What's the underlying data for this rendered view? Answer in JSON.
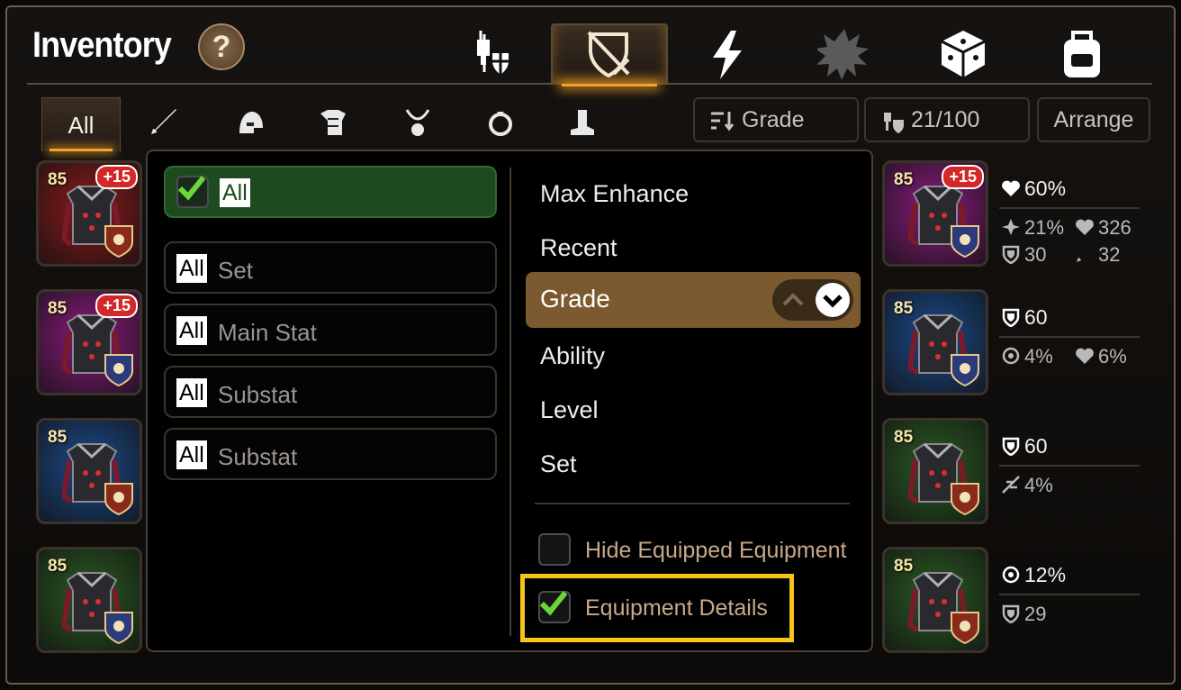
{
  "header": {
    "title": "Inventory",
    "help_label": "?",
    "tabs": [
      {
        "icon": "knight-helmet-shield-icon"
      },
      {
        "icon": "crossed-sword-shield-icon",
        "active": true
      },
      {
        "icon": "lightning-icon"
      },
      {
        "icon": "spiky-burst-icon"
      },
      {
        "icon": "dice-cube-icon"
      },
      {
        "icon": "backpack-icon"
      }
    ]
  },
  "categories": {
    "all_label": "All",
    "items": [
      {
        "icon": "sword-icon"
      },
      {
        "icon": "helmet-icon"
      },
      {
        "icon": "armor-icon"
      },
      {
        "icon": "necklace-icon"
      },
      {
        "icon": "ring-icon"
      },
      {
        "icon": "boots-icon"
      }
    ]
  },
  "toolbar": {
    "sort_label": "Grade",
    "capacity_label": "21/100",
    "arrange_label": "Arrange"
  },
  "left_items": [
    {
      "level": "85",
      "plus": "+15",
      "bg": "#8b1a1a",
      "badge_color": "#8a2a1a",
      "badge_icon": "sword-badge-icon"
    },
    {
      "level": "85",
      "plus": "+15",
      "bg": "#8b1a7e",
      "badge_color": "#2b3a7a",
      "badge_icon": "shield-badge-icon"
    },
    {
      "level": "85",
      "plus": "",
      "bg": "#1b4a8b",
      "badge_color": "#8a2a1a",
      "badge_icon": "gear-badge-icon"
    },
    {
      "level": "85",
      "plus": "",
      "bg": "#2a5a22",
      "badge_color": "#2b3a7a",
      "badge_icon": "star-badge-icon"
    }
  ],
  "right_items": [
    {
      "level": "85",
      "plus": "+15",
      "bg": "#8b1a7e",
      "badge_color": "#2b3a7a",
      "badge_icon": "heart-badge-icon",
      "main": {
        "icon": "heart-icon",
        "value": "60%"
      },
      "subs": [
        [
          {
            "icon": "crit-icon",
            "value": "21%"
          },
          {
            "icon": "heart-icon",
            "value": "326"
          }
        ],
        [
          {
            "icon": "shield-icon",
            "value": "30"
          },
          {
            "icon": "sword-icon",
            "value": "32"
          }
        ]
      ]
    },
    {
      "level": "85",
      "plus": "",
      "bg": "#1b4a8b",
      "badge_color": "#2b3a7a",
      "badge_icon": "crit-badge-icon",
      "main": {
        "icon": "shield-icon",
        "value": "60"
      },
      "subs": [
        [
          {
            "icon": "target-icon",
            "value": "4%"
          },
          {
            "icon": "heart-icon",
            "value": "6%"
          }
        ]
      ]
    },
    {
      "level": "85",
      "plus": "",
      "bg": "#2a5a22",
      "badge_color": "#8a2a1a",
      "badge_icon": "sword-badge-icon",
      "main": {
        "icon": "shield-icon",
        "value": "60"
      },
      "subs": [
        [
          {
            "icon": "speed-icon",
            "value": "4%"
          }
        ]
      ]
    },
    {
      "level": "85",
      "plus": "",
      "bg": "#2a5a22",
      "badge_color": "#8a2a1a",
      "badge_icon": "burst-badge-icon",
      "main": {
        "icon": "target-icon",
        "value": "12%"
      },
      "subs": [
        [
          {
            "icon": "shield-icon",
            "value": "29"
          }
        ]
      ]
    }
  ],
  "filter_panel": {
    "filters": [
      {
        "tag": "All",
        "label": "All",
        "checked": true
      },
      {
        "tag": "All",
        "label": "Set"
      },
      {
        "tag": "All",
        "label": "Main Stat"
      },
      {
        "tag": "All",
        "label": "Substat"
      },
      {
        "tag": "All",
        "label": "Substat"
      }
    ],
    "sort_options": [
      "Max Enhance",
      "Recent",
      "Grade",
      "Ability",
      "Level",
      "Set"
    ],
    "selected_sort": "Grade",
    "hide_equipped_label": "Hide Equipped Equipment",
    "hide_equipped_checked": false,
    "equipment_details_label": "Equipment Details",
    "equipment_details_checked": true
  },
  "colors": {
    "highlight": "#f5c518",
    "accent": "#f2a42a",
    "check": "#6ad63a"
  }
}
